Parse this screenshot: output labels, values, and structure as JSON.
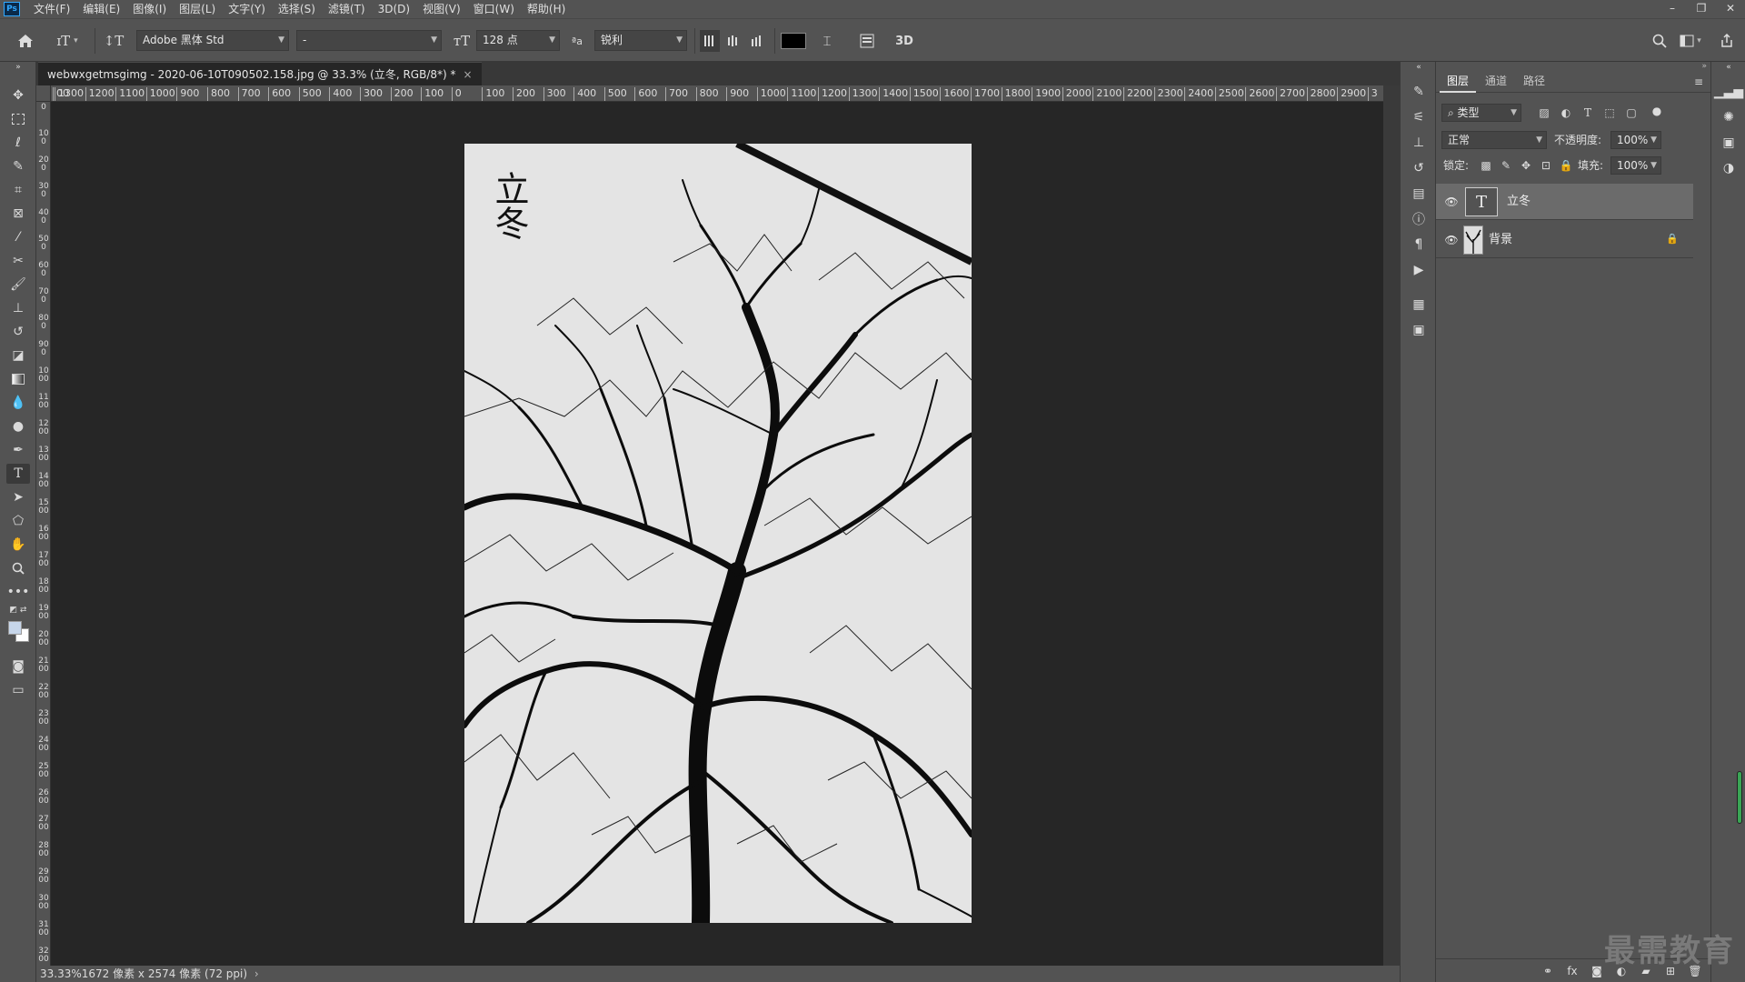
{
  "app": {
    "logo": "Ps"
  },
  "menu": [
    "文件(F)",
    "编辑(E)",
    "图像(I)",
    "图层(L)",
    "文字(Y)",
    "选择(S)",
    "滤镜(T)",
    "3D(D)",
    "视图(V)",
    "窗口(W)",
    "帮助(H)"
  ],
  "window_controls": {
    "minimize": "–",
    "restore": "❐",
    "close": "✕"
  },
  "options": {
    "font_family": "Adobe 黑体 Std",
    "font_style": "-",
    "font_size": "128 点",
    "aa_label": "ªa",
    "antialias": "锐利",
    "three_d": "3D",
    "text_color": "#000000"
  },
  "document": {
    "tab_title": "webwxgetmsgimg - 2020-06-10T090502.158.jpg @ 33.3% (立冬, RGB/8*) *",
    "tab_close": "×",
    "vertical_text": "立冬",
    "status": "33.33%1672 像素 x 2574 像素 (72 ppi)"
  },
  "ruler": {
    "h_labels": [
      "00",
      "1300",
      "1200",
      "1100",
      "1000",
      "900",
      "800",
      "700",
      "600",
      "500",
      "400",
      "300",
      "200",
      "100",
      "0",
      "100",
      "200",
      "300",
      "400",
      "500",
      "600",
      "700",
      "800",
      "900",
      "1000",
      "1100",
      "1200",
      "1300",
      "1400",
      "1500",
      "1600",
      "1700",
      "1800",
      "1900",
      "2000",
      "2100",
      "2200",
      "2300",
      "2400",
      "2500",
      "2600",
      "2700",
      "2800",
      "2900",
      "3"
    ],
    "v_labels": [
      "0",
      "100",
      "200",
      "300",
      "400",
      "500",
      "600",
      "700",
      "800",
      "900",
      "1000",
      "1100",
      "1200",
      "1300",
      "1400",
      "1500",
      "1600",
      "1700",
      "1800",
      "1900",
      "2000",
      "2100",
      "2200",
      "2300",
      "2400",
      "2500",
      "2600",
      "2700",
      "2800",
      "2900",
      "3000",
      "3100",
      "3200"
    ]
  },
  "layers_panel": {
    "tabs": [
      "图层",
      "通道",
      "路径"
    ],
    "filter": "类型",
    "blend_mode": "正常",
    "opacity_label": "不透明度:",
    "opacity_value": "100%",
    "lock_label": "锁定:",
    "fill_label": "填充:",
    "fill_value": "100%",
    "layers": [
      {
        "name": "立冬",
        "type": "text",
        "selected": true
      },
      {
        "name": "背景",
        "type": "image",
        "locked": true
      }
    ]
  },
  "watermark": "最需教育",
  "colors": {
    "panel": "#535353",
    "canvas_bg": "#262626",
    "selected_layer": "#6b6b6b"
  }
}
